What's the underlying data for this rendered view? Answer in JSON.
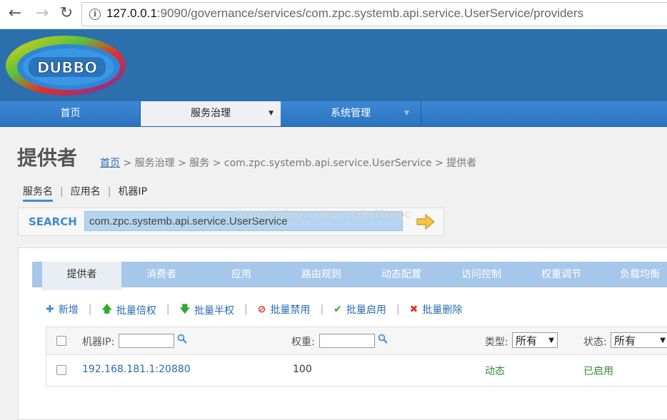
{
  "browser": {
    "url_host": "127.0.0.1",
    "url_rest": ":9090/governance/services/com.zpc.systemb.api.service.UserService/providers"
  },
  "logo": {
    "text": "DUBBO"
  },
  "nav": {
    "items": [
      {
        "label": "首页"
      },
      {
        "label": "服务治理"
      },
      {
        "label": "系统管理"
      }
    ]
  },
  "page": {
    "title": "提供者",
    "breadcrumb": {
      "home": "首页",
      "rest": " > 服务治理 > 服务 > com.zpc.systemb.api.service.UserService > 提供者"
    }
  },
  "search": {
    "tabs": [
      "服务名",
      "应用名",
      "机器IP"
    ],
    "label": "SEARCH",
    "value": "com.zpc.systemb.api.service.UserService",
    "watermark": "http://blog.csdn.net/helloxpc"
  },
  "tabs": [
    "提供者",
    "消费者",
    "应用",
    "路由规则",
    "动态配置",
    "访问控制",
    "权重调节",
    "负载均衡"
  ],
  "actions": {
    "add": "新增",
    "double_weight": "批量倍权",
    "half_weight": "批量半权",
    "disable": "批量禁用",
    "enable": "批量启用",
    "delete": "批量删除"
  },
  "table": {
    "headers": {
      "ip": "机器IP:",
      "weight": "权重:",
      "type": "类型:",
      "type_value": "所有",
      "status": "状态:",
      "status_value": "所有"
    },
    "rows": [
      {
        "address": "192.168.181.1:20880",
        "weight": "100",
        "type": "动态",
        "status": "已启用"
      }
    ]
  },
  "colors": {
    "header_bg": "#2b6fad",
    "nav_bg": "#3d88d4",
    "tab_bg": "#a6c7ea",
    "link": "#2a6bb5",
    "status_green": "#2e8b2e"
  }
}
